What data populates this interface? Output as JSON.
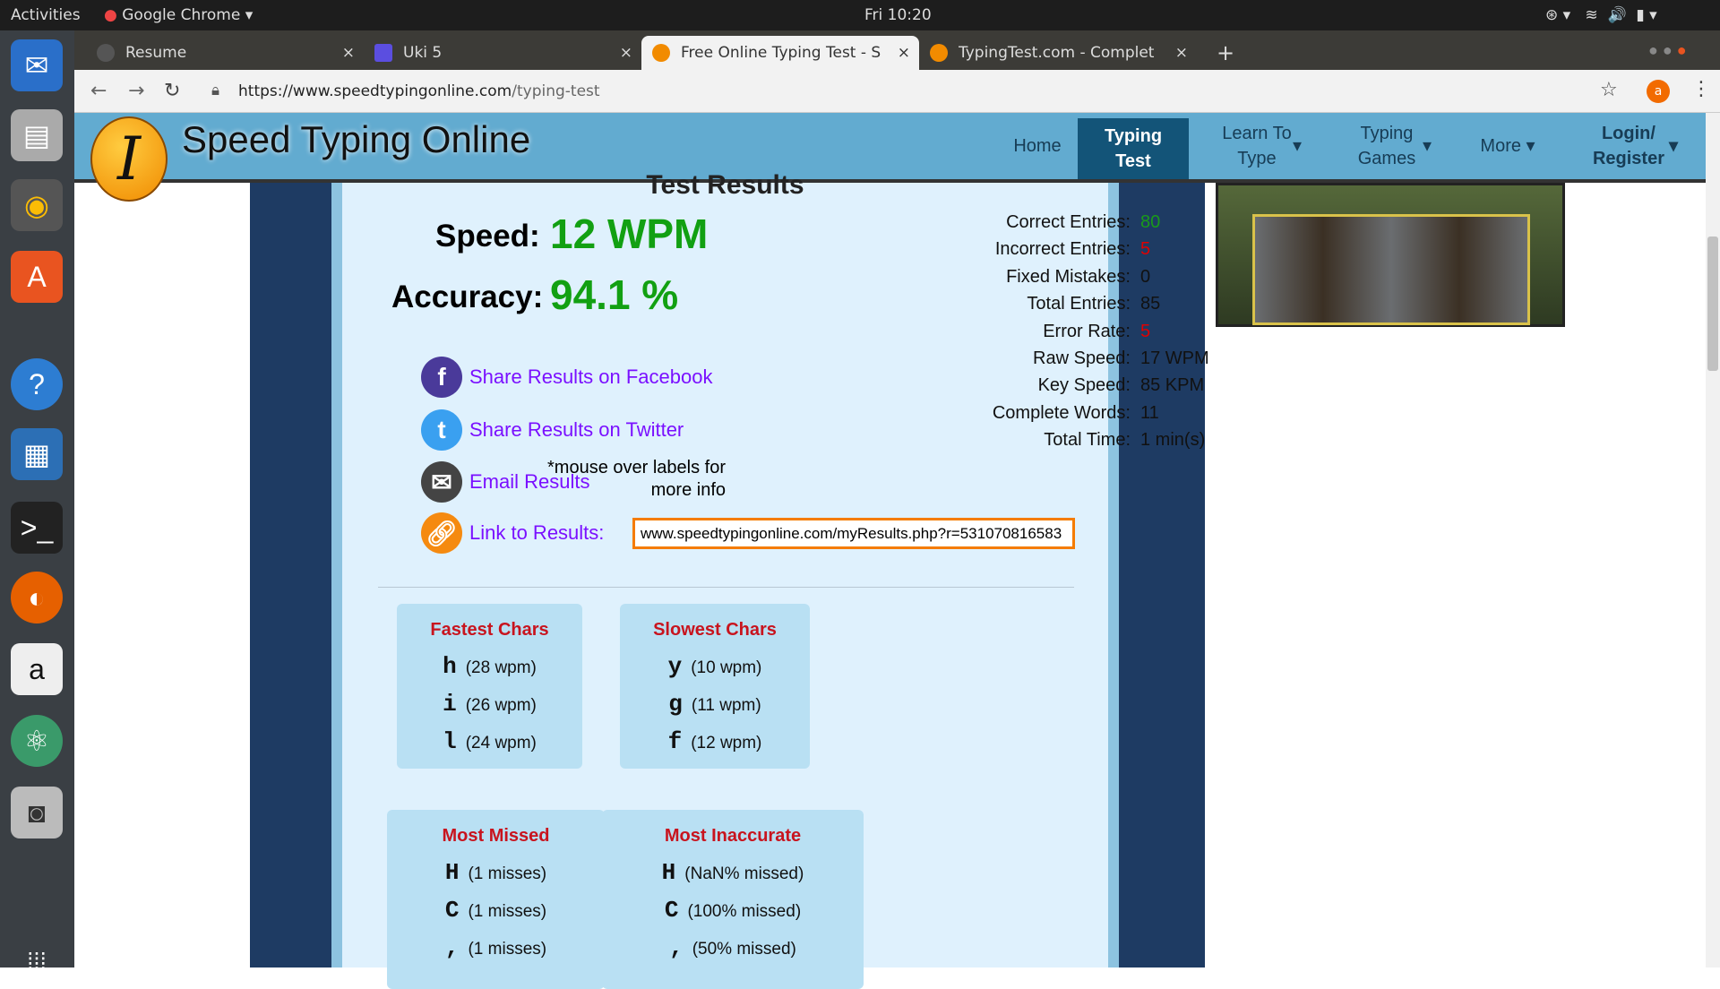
{
  "system": {
    "activities": "Activities",
    "app": "Google Chrome",
    "clock": "Fri 10:20"
  },
  "tabs": [
    {
      "label": "Resume"
    },
    {
      "label": "Uki 5"
    },
    {
      "label": "Free Online Typing Test - S"
    },
    {
      "label": "TypingTest.com - Complet"
    }
  ],
  "address": {
    "domain": "https://www.speedtypingonline.com",
    "path": "/typing-test",
    "profile": "a"
  },
  "site": {
    "title": "Speed Typing Online",
    "nav": [
      "Home",
      "Typing Test",
      "Learn To Type",
      "Typing Games",
      "More",
      "Login/ Register"
    ]
  },
  "results": {
    "heading": "Test Results",
    "speed_label": "Speed:",
    "speed": "12 WPM",
    "accuracy_label": "Accuracy:",
    "accuracy": "94.1 %",
    "stats": [
      {
        "label": "Correct Entries:",
        "value": "80",
        "color": "#1a9a1a"
      },
      {
        "label": "Incorrect Entries:",
        "value": "5",
        "color": "#e00000"
      },
      {
        "label": "Fixed Mistakes:",
        "value": "0",
        "color": "#111"
      },
      {
        "label": "Total Entries:",
        "value": "85",
        "color": "#111"
      },
      {
        "label": "Error Rate:",
        "value": "5",
        "color": "#e00000"
      },
      {
        "label": "Raw Speed:",
        "value": "17 WPM",
        "color": "#111"
      },
      {
        "label": "Key Speed:",
        "value": "85 KPM",
        "color": "#111"
      },
      {
        "label": "Complete Words:",
        "value": "11",
        "color": "#111"
      },
      {
        "label": "Total Time:",
        "value": "1 min(s)",
        "color": "#111"
      }
    ],
    "note1": "*mouse over labels for",
    "note2": "more info",
    "share_facebook": "Share Results on Facebook",
    "share_twitter": "Share Results on Twitter",
    "email": "Email Results",
    "link_label": "Link to Results:",
    "link_value": "www.speedtypingonline.com/myResults.php?r=531070816583"
  },
  "boxes": [
    {
      "title": "Fastest Chars",
      "rows": [
        {
          "c": "h",
          "t": "(28 wpm)"
        },
        {
          "c": "i",
          "t": "(26 wpm)"
        },
        {
          "c": "l",
          "t": "(24 wpm)"
        }
      ]
    },
    {
      "title": "Slowest Chars",
      "rows": [
        {
          "c": "y",
          "t": "(10 wpm)"
        },
        {
          "c": "g",
          "t": "(11 wpm)"
        },
        {
          "c": "f",
          "t": "(12 wpm)"
        }
      ]
    },
    {
      "title": "Most Missed",
      "rows": [
        {
          "c": "H",
          "t": "(1 misses)"
        },
        {
          "c": "C",
          "t": "(1 misses)"
        },
        {
          "c": ",",
          "t": "(1 misses)"
        }
      ]
    },
    {
      "title": "Most Inaccurate",
      "rows": [
        {
          "c": "H",
          "t": "(NaN% missed)"
        },
        {
          "c": "C",
          "t": "(100% missed)"
        },
        {
          "c": ",",
          "t": "(50% missed)"
        }
      ]
    }
  ]
}
